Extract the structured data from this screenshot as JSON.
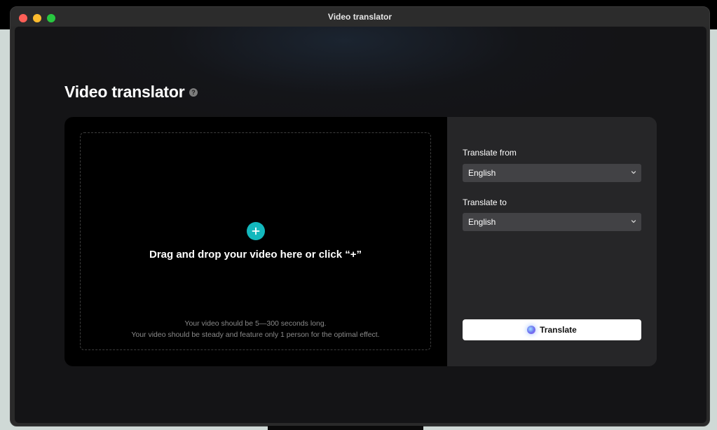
{
  "window": {
    "title": "Video translator"
  },
  "page": {
    "title": "Video translator",
    "help_icon": "question-circle-icon"
  },
  "upload": {
    "drop_text": "Drag and drop your video here or click “+”",
    "hint_duration": "Your video should be 5—300 seconds long.",
    "hint_steady": "Your video should be steady and feature only 1 person for the optimal effect.",
    "plus_icon": "plus-icon",
    "accent_color": "#13b8bd"
  },
  "settings": {
    "from_label": "Translate from",
    "from_value": "English",
    "to_label": "Translate to",
    "to_value": "English",
    "translate_label": "Translate"
  }
}
